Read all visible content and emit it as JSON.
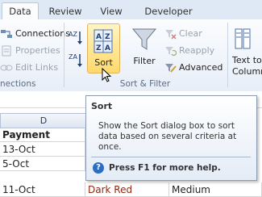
{
  "tabs": [
    "Data",
    "Review",
    "View",
    "Developer"
  ],
  "connections_group": {
    "connections": "Connections",
    "properties": "Properties",
    "edit_links": "Edit Links",
    "label": "nections"
  },
  "sort_filter_group": {
    "sort": "Sort",
    "filter": "Filter",
    "clear": "Clear",
    "reapply": "Reapply",
    "advanced": "Advanced",
    "label": "Sort & Filter",
    "sort_az_glyph": "AZ",
    "sort_za_glyph": "ZA"
  },
  "text_to_columns": {
    "line1": "Text to",
    "line2": "Column"
  },
  "sheet": {
    "column_letter": "D",
    "rows": [
      {
        "payment": "Payment",
        "e": "",
        "f": ""
      },
      {
        "payment": "13-Oct",
        "e": "",
        "f": ""
      },
      {
        "payment": "5-Oct",
        "e": "",
        "f": ""
      },
      {
        "payment": "11-Oct",
        "e": "Dark Red",
        "f": "Medium"
      }
    ]
  },
  "tooltip": {
    "title": "Sort",
    "body": "Show the Sort dialog box to sort data based on several criteria at once.",
    "help": "Press F1 for more help.",
    "help_glyph": "?"
  },
  "colors": {
    "selected_button": "#ffd96b",
    "dark_red_text": "#8b2a12",
    "help_icon": "#2b6cc4"
  }
}
